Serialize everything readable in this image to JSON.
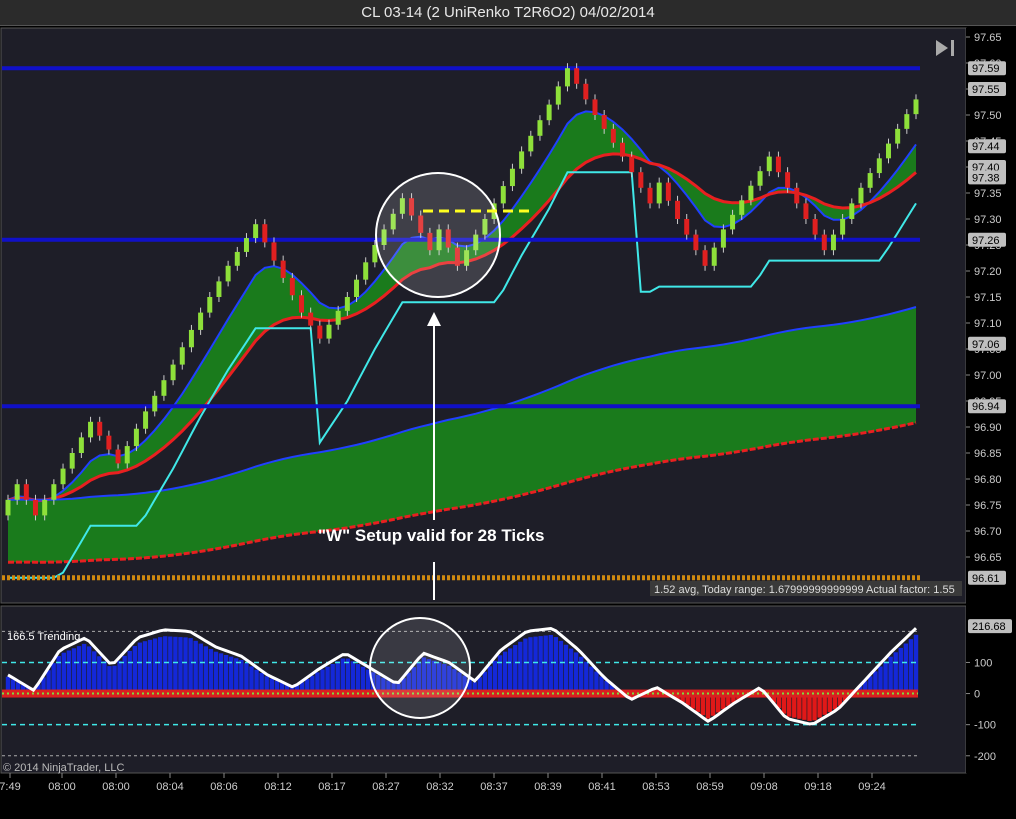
{
  "title": "CL 03-14 (2 UniRenko T2R6O2)  04/02/2014",
  "annotation": "\"W\" Setup valid for 28 Ticks",
  "range_text": "1.52 avg, Today range: 1.67999999999999  Actual factor: 1.55",
  "indicator_label": "166.5 Trending",
  "copyright": "© 2014 NinjaTrader, LLC",
  "colors": {
    "up_bar": "#8ee03a",
    "down_bar": "#e02020",
    "panel_bg": "#1e1e28",
    "level_line": "#1010c8",
    "trail_line": "#40e8e8",
    "fill": "#1a8c1a"
  },
  "chart_data": [
    {
      "type": "candlestick",
      "title": "CL 03-14 (2 UniRenko T2R6O2)  04/02/2014",
      "ylim": [
        96.6,
        97.65
      ],
      "y_ticks": [
        96.65,
        96.7,
        96.75,
        96.8,
        96.85,
        96.9,
        96.95,
        97.0,
        97.05,
        97.1,
        97.15,
        97.2,
        97.25,
        97.3,
        97.35,
        97.4,
        97.45,
        97.5,
        97.55,
        97.6,
        97.65
      ],
      "y_tick_labels": [
        "96.65",
        "96.70",
        "96.75",
        "96.80",
        "96.85",
        "96.90",
        "96.95",
        "97.00",
        "97.05",
        "97.10",
        "97.15",
        "97.20",
        "97.25",
        "97.30",
        "97.35",
        "97.40",
        "97.45",
        "97.50",
        "97.55",
        "97.60",
        "97.65"
      ],
      "x_tick_labels": [
        "7:49",
        "08:00",
        "08:00",
        "08:04",
        "08:06",
        "08:12",
        "08:17",
        "08:27",
        "08:32",
        "08:37",
        "08:39",
        "08:41",
        "08:53",
        "08:59",
        "09:08",
        "09:18",
        "09:24"
      ],
      "price_flags": [
        {
          "label": "97.59",
          "value": 97.59
        },
        {
          "label": "97.55",
          "value": 97.55
        },
        {
          "label": "97.44",
          "value": 97.44
        },
        {
          "label": "97.40",
          "value": 97.4
        },
        {
          "label": "97.38",
          "value": 97.38
        },
        {
          "label": "97.26",
          "value": 97.26
        },
        {
          "label": "97.06",
          "value": 97.06
        },
        {
          "label": "96.94",
          "value": 96.94
        },
        {
          "label": "96.61",
          "value": 96.61
        }
      ],
      "horizontal_levels": [
        97.59,
        97.26,
        96.94
      ],
      "orange_level": 96.61,
      "close_path": [
        96.73,
        96.79,
        96.73,
        96.82,
        96.91,
        96.83,
        96.93,
        97.02,
        97.12,
        97.21,
        97.29,
        97.22,
        97.12,
        97.07,
        97.15,
        97.25,
        97.34,
        97.24,
        97.28,
        97.21,
        97.33,
        97.43,
        97.52,
        97.59,
        97.5,
        97.42,
        97.33,
        97.37,
        97.3,
        97.21,
        97.28,
        97.42,
        97.33,
        97.24,
        97.36,
        97.53
      ]
    },
    {
      "type": "histogram",
      "title": "166.5 Trending",
      "ylim": [
        -220,
        230
      ],
      "y_ticks": [
        -200,
        -100,
        0,
        100
      ],
      "y_tick_labels": [
        "-200",
        "-100",
        "0",
        "100"
      ],
      "current_value_label": "216.68",
      "current_value": 216.68,
      "line_path": [
        60,
        10,
        140,
        180,
        90,
        180,
        205,
        200,
        150,
        120,
        60,
        20,
        80,
        130,
        80,
        30,
        130,
        100,
        40,
        140,
        200,
        210,
        140,
        50,
        -20,
        20,
        -30,
        -90,
        -30,
        20,
        -80,
        -100,
        -50,
        40,
        130,
        210
      ]
    }
  ]
}
